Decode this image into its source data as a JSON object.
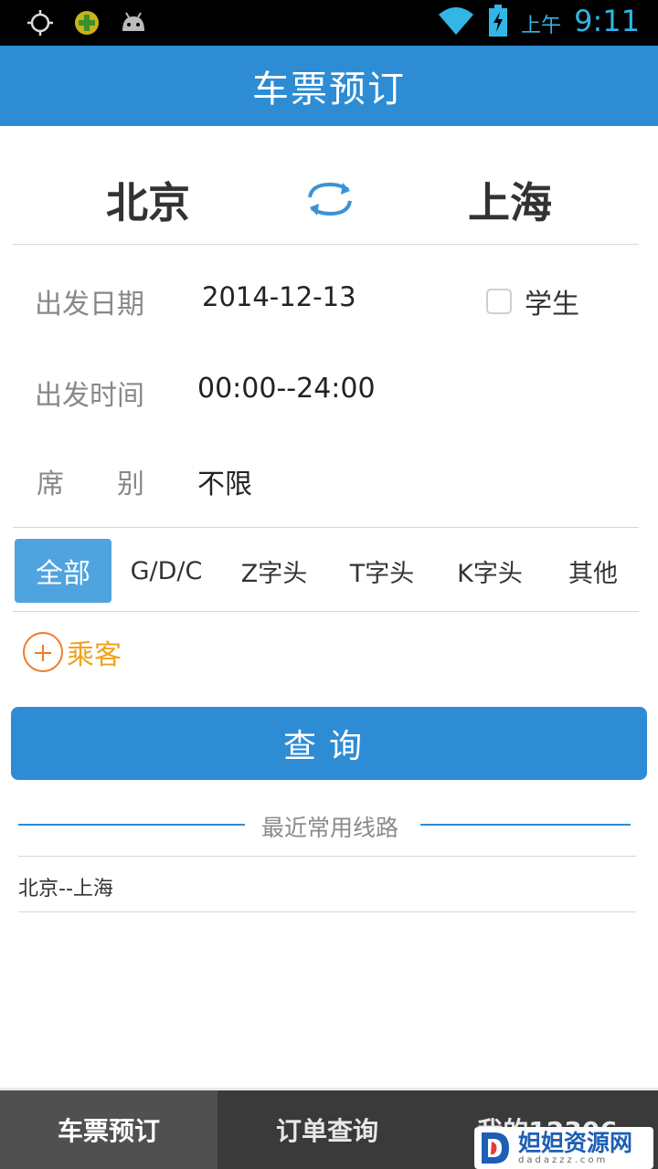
{
  "status_bar": {
    "icons": [
      "gps-icon",
      "add-notification-icon",
      "android-icon",
      "wifi-icon",
      "battery-charging-icon"
    ],
    "ampm": "上午",
    "time": "9:11"
  },
  "title": "车票预订",
  "route": {
    "from": "北京",
    "to": "上海"
  },
  "form": {
    "date_label": "出发日期",
    "date_value": "2014-12-13",
    "student_label": "学生",
    "student_checked": false,
    "time_label": "出发时间",
    "time_value": "00:00--24:00",
    "seat_label_1": "席",
    "seat_label_2": "别",
    "seat_value": "不限"
  },
  "train_types": [
    {
      "label": "全部",
      "active": true
    },
    {
      "label": "G/D/C",
      "active": false
    },
    {
      "label": "Z字头",
      "active": false
    },
    {
      "label": "T字头",
      "active": false
    },
    {
      "label": "K字头",
      "active": false
    },
    {
      "label": "其他",
      "active": false
    }
  ],
  "passenger_label": "乘客",
  "query_button": "查询",
  "recent": {
    "title": "最近常用线路",
    "items": [
      "北京--上海"
    ]
  },
  "bottom_nav": [
    {
      "label": "车票预订",
      "active": true
    },
    {
      "label": "订单查询",
      "active": false
    },
    {
      "label": "我的12306",
      "active": false
    }
  ],
  "watermark": {
    "main": "妲妲资源网",
    "sub": "dadazzz.com"
  },
  "colors": {
    "primary": "#2d8cd4",
    "tab_active": "#4fa3df",
    "passenger_orange": "#f07a2a",
    "passenger_text": "#f0a21a",
    "status_blue": "#33b5e5"
  }
}
